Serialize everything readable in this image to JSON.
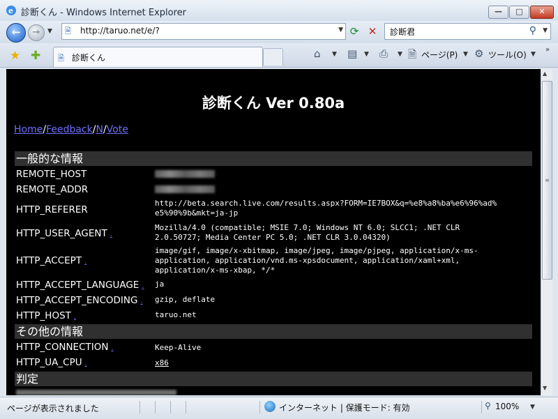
{
  "window": {
    "title": "診断くん - Windows Internet Explorer",
    "min": "—",
    "max": "□",
    "close": "✕"
  },
  "nav": {
    "back": "←",
    "forward": "→",
    "url": "http://taruo.net/e/?",
    "search_value": "診断君"
  },
  "tab": {
    "title": "診断くん"
  },
  "commands": {
    "page": "ページ(P)",
    "tools": "ツール(O)"
  },
  "page": {
    "heading": "診断くん Ver 0.80a",
    "links": [
      "Home",
      "Feedback",
      "N",
      "Vote"
    ],
    "sections": [
      {
        "title": "一般的な情報",
        "rows": [
          {
            "name": "REMOTE_HOST",
            "value": ""
          },
          {
            "name": "REMOTE_ADDR",
            "value": ""
          },
          {
            "name": "HTTP_REFERER",
            "value": "http://beta.search.live.com/results.aspx?FORM=IE7BOX&q=%e8%a8%ba%e6%96%ad%\ne5%90%9b&mkt=ja-jp"
          },
          {
            "name": "HTTP_USER_AGENT",
            "value": "Mozilla/4.0 (compatible; MSIE 7.0; Windows NT 6.0; SLCC1; .NET CLR\n2.0.50727; Media Center PC 5.0; .NET CLR 3.0.04320)"
          },
          {
            "name": "HTTP_ACCEPT",
            "value": "image/gif, image/x-xbitmap, image/jpeg, image/pjpeg, application/x-ms-\napplication, application/vnd.ms-xpsdocument, application/xaml+xml,\napplication/x-ms-xbap, */*"
          },
          {
            "name": "HTTP_ACCEPT_LANGUAGE",
            "value": "ja"
          },
          {
            "name": "HTTP_ACCEPT_ENCODING",
            "value": "gzip, deflate"
          },
          {
            "name": "HTTP_HOST",
            "value": "taruo.net"
          }
        ]
      },
      {
        "title": "その他の情報",
        "rows": [
          {
            "name": "HTTP_CONNECTION",
            "value": "Keep-Alive"
          },
          {
            "name": "HTTP_UA_CPU",
            "value": "x86"
          }
        ]
      },
      {
        "title": "判定"
      }
    ]
  },
  "status": {
    "message": "ページが表示されました",
    "zone": "インターネット | 保護モード: 有効",
    "zoom": "100%"
  }
}
